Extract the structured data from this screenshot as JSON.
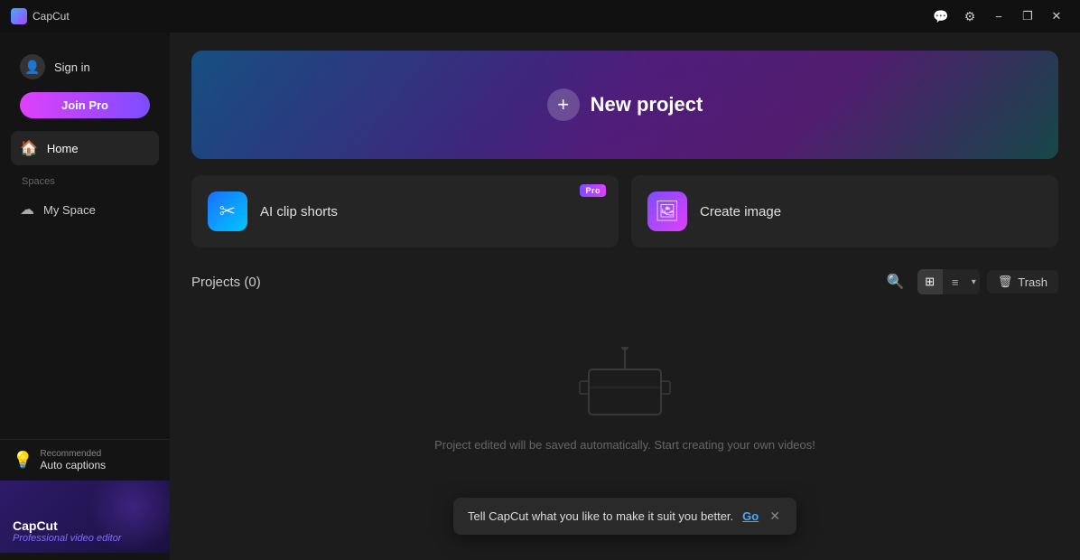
{
  "app": {
    "name": "CapCut"
  },
  "titlebar": {
    "title": "CapCut",
    "feedback_icon": "💬",
    "settings_icon": "⚙",
    "minimize_label": "−",
    "restore_label": "❐",
    "close_label": "✕"
  },
  "sidebar": {
    "signin_label": "Sign in",
    "join_pro_label": "Join Pro",
    "home_label": "Home",
    "spaces_label": "Spaces",
    "my_space_label": "My Space",
    "recommendation_label": "Recommended",
    "recommendation_title": "Auto captions",
    "promo_title": "CapCut",
    "promo_sub1": "Professional video",
    "promo_sub2": "editor"
  },
  "banner": {
    "plus_symbol": "+",
    "label": "New project"
  },
  "quick_actions": [
    {
      "id": "ai-clip-shorts",
      "label": "AI clip shorts",
      "icon": "✂",
      "pro": true,
      "pro_label": "Pro"
    },
    {
      "id": "create-image",
      "label": "Create image",
      "icon": "🖼",
      "pro": false
    }
  ],
  "projects": {
    "title": "Projects",
    "count": "(0)",
    "search_icon": "🔍",
    "grid_icon": "⊞",
    "list_icon": "≡",
    "trash_icon": "🗑",
    "trash_label": "Trash",
    "empty_text": "Project edited will be saved automatically. Start creating your own videos!"
  },
  "toast": {
    "message": "Tell CapCut what you like to make it suit you better.",
    "go_label": "Go",
    "close_symbol": "✕"
  }
}
